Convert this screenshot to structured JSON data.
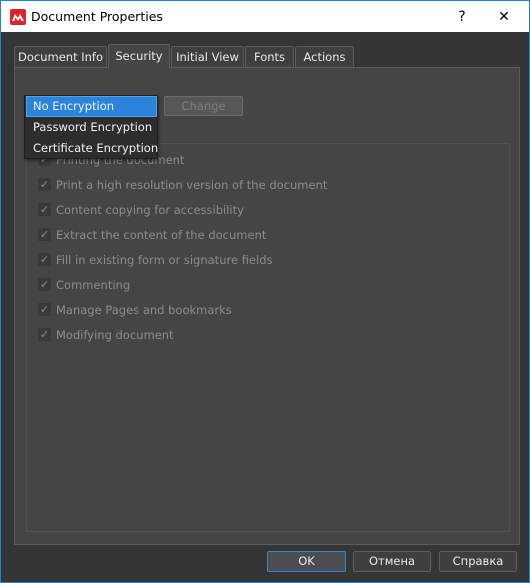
{
  "window": {
    "title": "Document Properties",
    "help_label": "?",
    "close_label": "✕",
    "app_icon": "app-logo-icon"
  },
  "tabs": [
    {
      "label": "Document Info",
      "active": false
    },
    {
      "label": "Security",
      "active": true
    },
    {
      "label": "Initial View",
      "active": false
    },
    {
      "label": "Fonts",
      "active": false
    },
    {
      "label": "Actions",
      "active": false
    }
  ],
  "security": {
    "encryption_dropdown": {
      "selected": "No Encryption",
      "options": [
        "No Encryption",
        "Password Encryption",
        "Certificate Encryption"
      ]
    },
    "change_button_label": "Change",
    "change_button_enabled": false,
    "permissions": [
      {
        "label": "Printing the document",
        "checked": true
      },
      {
        "label": "Print a high resolution version of the document",
        "checked": true
      },
      {
        "label": "Content copying for accessibility",
        "checked": true
      },
      {
        "label": "Extract the content of the document",
        "checked": true
      },
      {
        "label": "Fill in existing form or signature fields",
        "checked": true
      },
      {
        "label": "Commenting",
        "checked": true
      },
      {
        "label": "Manage Pages and bookmarks",
        "checked": true
      },
      {
        "label": "Modifying document",
        "checked": true
      }
    ],
    "check_glyph": "✓"
  },
  "footer": {
    "ok_label": "OK",
    "cancel_label": "Отмена",
    "help_label": "Справка"
  },
  "colors": {
    "accent": "#2b83da",
    "window_border": "#1c84d6",
    "app_icon": "#d8262c"
  }
}
